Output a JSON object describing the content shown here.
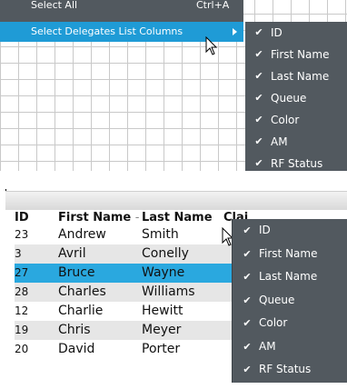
{
  "top_menu": {
    "items": [
      {
        "label": "Select All",
        "shortcut": "Ctrl+A"
      },
      {
        "label": "Select Delegates List Columns",
        "shortcut": ""
      }
    ]
  },
  "submenu": {
    "check": "✔",
    "items_top": [
      "ID",
      "First Name",
      "Last Name",
      "Queue",
      "Color",
      "AM",
      "RF Status"
    ],
    "items_bottom": [
      "ID",
      "First Name",
      "Last Name",
      "Queue",
      "Color",
      "AM",
      "RF Status"
    ]
  },
  "table": {
    "columns": [
      "ID",
      "First Name",
      "Last Name",
      "Clai"
    ],
    "sort_indicator": "-",
    "rows": [
      {
        "id": "23",
        "first": "Andrew",
        "last": "Smith",
        "color": ""
      },
      {
        "id": "3",
        "first": "Avril",
        "last": "Conelly",
        "color": ""
      },
      {
        "id": "27",
        "first": "Bruce",
        "last": "Wayne",
        "color": ""
      },
      {
        "id": "28",
        "first": "Charles",
        "last": "Williams",
        "color": ""
      },
      {
        "id": "12",
        "first": "Charlie",
        "last": "Hewitt",
        "color": ""
      },
      {
        "id": "19",
        "first": "Chris",
        "last": "Meyer",
        "color": ""
      },
      {
        "id": "20",
        "first": "David",
        "last": "Porter",
        "color": ""
      }
    ]
  },
  "colors": {
    "menu_bg": "#52595f",
    "menu_highlight": "#1f9bd6",
    "row_selected": "#2aa8df",
    "row_gray": "#e6e6e6"
  }
}
